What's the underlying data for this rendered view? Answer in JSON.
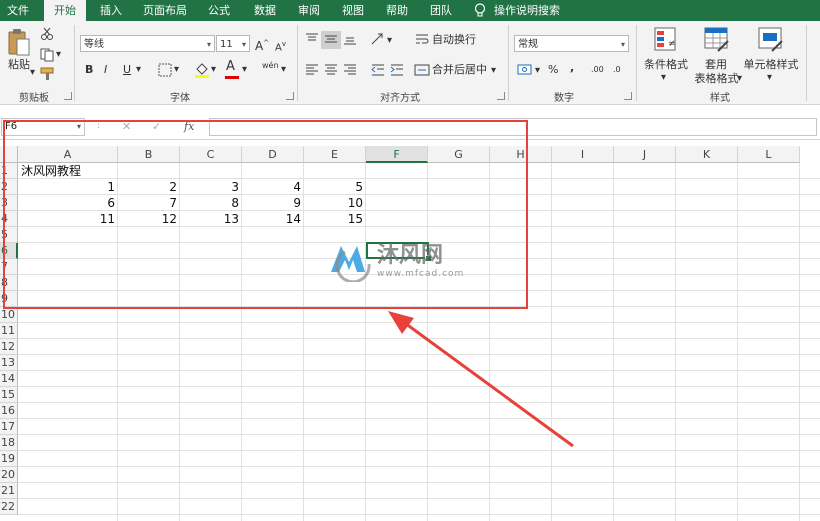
{
  "tabs": [
    "文件",
    "开始",
    "插入",
    "页面布局",
    "公式",
    "数据",
    "审阅",
    "视图",
    "帮助",
    "团队",
    "操作说明搜索"
  ],
  "active_tab": "开始",
  "ribbon": {
    "clipboard": {
      "paste": "粘贴",
      "group": "剪贴板"
    },
    "font": {
      "name": "等线",
      "size": "11",
      "bold": "B",
      "italic": "I",
      "underline": "U",
      "grow": "A",
      "shrink": "A",
      "font_color": "A",
      "phonetic": "wén",
      "group": "字体"
    },
    "alignment": {
      "wrap": "自动换行",
      "merge": "合并后居中",
      "group": "对齐方式"
    },
    "number": {
      "format": "常规",
      "percent": "%",
      "comma": ",",
      "inc_decimal": ".00",
      "dec_decimal": ".0",
      "group": "数字"
    },
    "styles": {
      "conditional": "条件格式",
      "table_line1": "套用",
      "table_line2": "表格格式",
      "cell_styles": "单元格样式",
      "group": "样式"
    }
  },
  "formula_bar": {
    "name_box": "F6",
    "cancel": "✕",
    "enter": "✓",
    "fx": "fx",
    "value": ""
  },
  "columns": [
    "A",
    "B",
    "C",
    "D",
    "E",
    "F",
    "G",
    "H",
    "I",
    "J",
    "K",
    "L"
  ],
  "selected_column": "F",
  "rows": [
    "1",
    "2",
    "3",
    "4",
    "5",
    "6",
    "7",
    "8",
    "9",
    "10",
    "11",
    "12",
    "13",
    "14",
    "15",
    "16",
    "17",
    "18",
    "19",
    "20",
    "21",
    "22"
  ],
  "selected_row": "6",
  "cells": {
    "A1": "沐风网教程",
    "A2": "1",
    "B2": "2",
    "C2": "3",
    "D2": "4",
    "E2": "5",
    "A3": "6",
    "B3": "7",
    "C3": "8",
    "D3": "9",
    "E3": "10",
    "A4": "11",
    "B4": "12",
    "C4": "13",
    "D4": "14",
    "E4": "15"
  },
  "watermark": {
    "title": "沐风网",
    "url": "www.mfcad.com"
  },
  "colors": {
    "excel_green": "#217346",
    "annotation_red": "#e8413a"
  }
}
